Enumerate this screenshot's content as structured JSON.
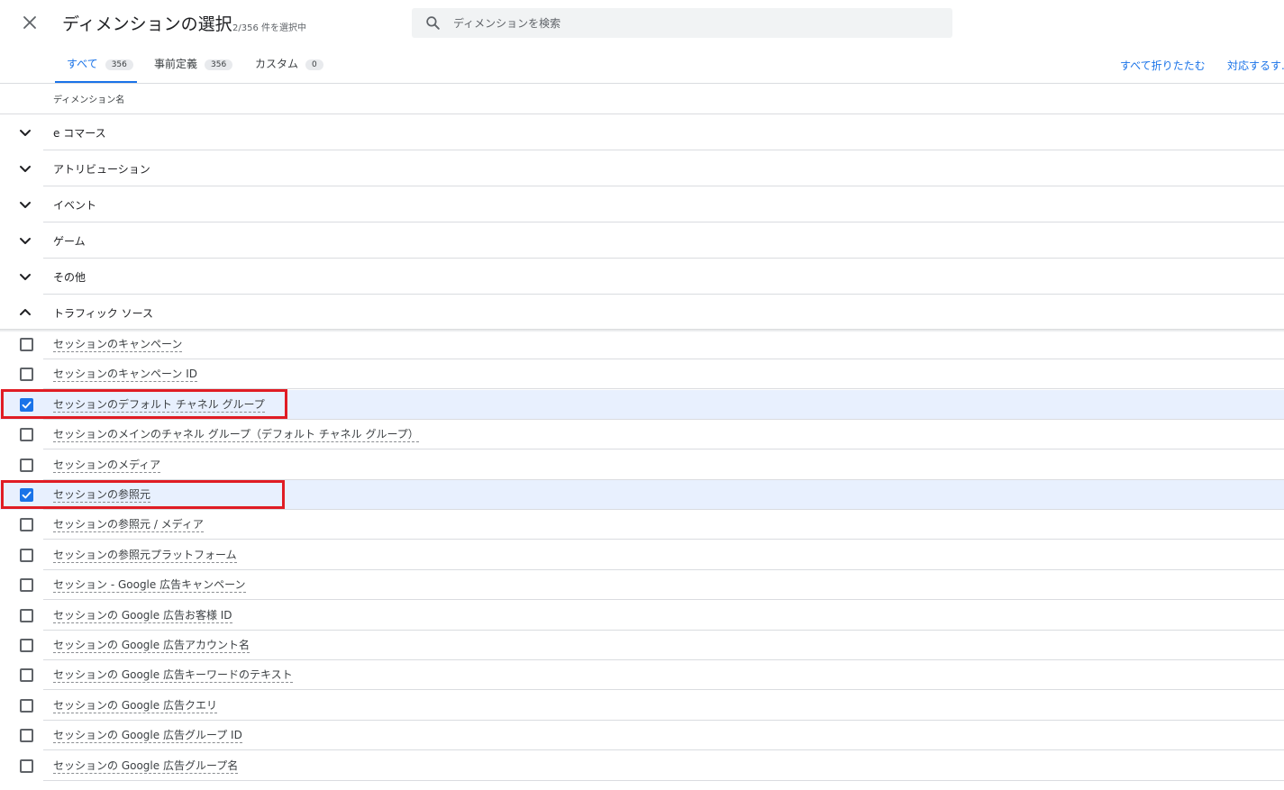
{
  "header": {
    "title": "ディメンションの選択",
    "selected_count": "2/356 件を選択中",
    "search_placeholder": "ディメンションを検索"
  },
  "tabs": [
    {
      "label": "すべて",
      "count": "356",
      "active": true
    },
    {
      "label": "事前定義",
      "count": "356",
      "active": false
    },
    {
      "label": "カスタム",
      "count": "0",
      "active": false
    }
  ],
  "actions": {
    "collapse_all": "すべて折りたたむ",
    "expand_all": "対応するす..."
  },
  "table": {
    "column_header": "ディメンション名"
  },
  "categories": [
    {
      "label": "e コマース",
      "expanded": false
    },
    {
      "label": "アトリビューション",
      "expanded": false
    },
    {
      "label": "イベント",
      "expanded": false
    },
    {
      "label": "ゲーム",
      "expanded": false
    },
    {
      "label": "その他",
      "expanded": false
    },
    {
      "label": "トラフィック ソース",
      "expanded": true
    }
  ],
  "dimensions": [
    {
      "label": "セッションのキャンペーン",
      "checked": false
    },
    {
      "label": "セッションのキャンペーン ID",
      "checked": false
    },
    {
      "label": "セッションのデフォルト チャネル グループ",
      "checked": true
    },
    {
      "label": "セッションのメインのチャネル グループ（デフォルト チャネル グループ）",
      "checked": false
    },
    {
      "label": "セッションのメディア",
      "checked": false
    },
    {
      "label": "セッションの参照元",
      "checked": true
    },
    {
      "label": "セッションの参照元 / メディア",
      "checked": false
    },
    {
      "label": "セッションの参照元プラットフォーム",
      "checked": false
    },
    {
      "label": "セッション - Google 広告キャンペーン",
      "checked": false
    },
    {
      "label": "セッションの Google 広告お客様 ID",
      "checked": false
    },
    {
      "label": "セッションの Google 広告アカウント名",
      "checked": false
    },
    {
      "label": "セッションの Google 広告キーワードのテキスト",
      "checked": false
    },
    {
      "label": "セッションの Google 広告クエリ",
      "checked": false
    },
    {
      "label": "セッションの Google 広告グループ ID",
      "checked": false
    },
    {
      "label": "セッションの Google 広告グループ名",
      "checked": false
    }
  ],
  "colors": {
    "accent": "#1a73e8",
    "checked_row_bg": "#e8f0fe",
    "highlight_border": "#e01c24"
  }
}
